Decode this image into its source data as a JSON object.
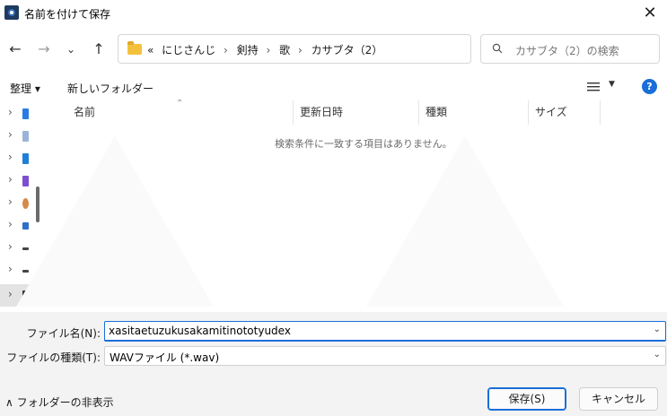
{
  "window": {
    "title": "名前を付けて保存",
    "close_glyph": "✕"
  },
  "nav": {
    "back": "←",
    "forward": "→",
    "recent": "⌄",
    "up": "↑",
    "breadcrumb_overflow": "«",
    "breadcrumbs": [
      "にじさんじ",
      "剣持",
      "歌",
      "カサブタ（2）"
    ],
    "separator": "›",
    "dropdown": "⌄",
    "refresh": "↻"
  },
  "search": {
    "placeholder": "カサブタ（2）の検索"
  },
  "toolbar": {
    "organize": "整理 ▾",
    "new_folder": "新しいフォルダー",
    "help": "?"
  },
  "columns": {
    "name": "名前",
    "modified": "更新日時",
    "type": "種類",
    "size": "サイズ"
  },
  "list": {
    "empty_message": "検索条件に一致する項目はありません。"
  },
  "fields": {
    "filename_label": "ファイル名(N):",
    "filename_value": "xasitaetuzukusakamitinototyudex",
    "filetype_label": "ファイルの種類(T):",
    "filetype_value": "WAVファイル (*.wav)"
  },
  "footer": {
    "hide_folders": "∧ フォルダーの非表示",
    "save": "保存(S)",
    "cancel": "キャンセル"
  },
  "colors": {
    "accent": "#1a6ed8",
    "folder": "#f3c23d"
  },
  "sidebar_icons": [
    "#2a7be4",
    "#9ab4d8",
    "#1e7fd6",
    "#7b4fd0",
    "#d68a4a",
    "#2d6fc9",
    "#444444",
    "#444444",
    "#333333"
  ]
}
